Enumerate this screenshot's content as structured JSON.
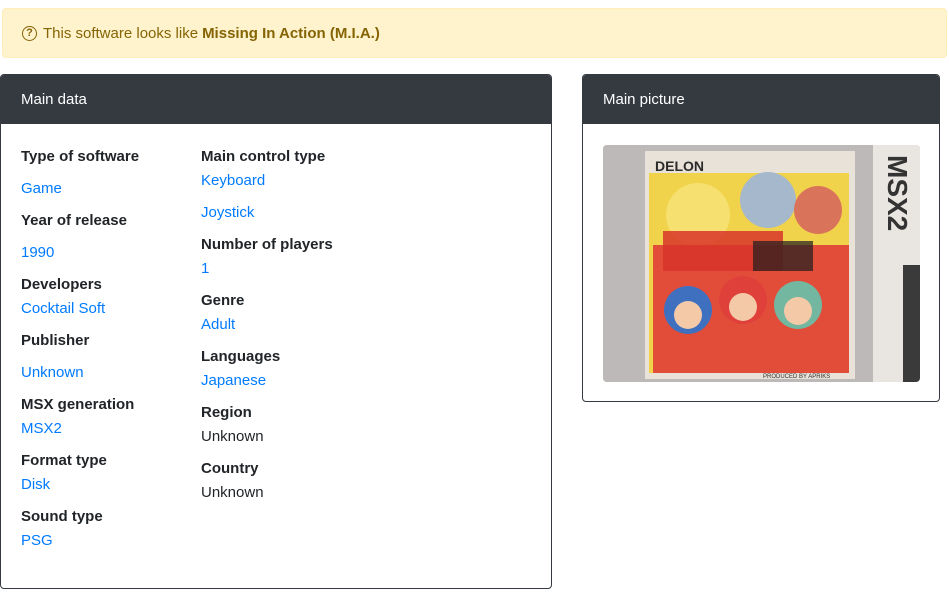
{
  "alert": {
    "prefix": "This software looks like",
    "title": "Missing In Action (M.I.A.)",
    "icon": "question-circle-icon"
  },
  "main_data": {
    "header": "Main data",
    "left": {
      "type_label": "Type of software",
      "type_value": "Game",
      "year_label": "Year of release",
      "year_value": "1990",
      "dev_label": "Developers",
      "dev_value": "Cocktail Soft",
      "pub_label": "Publisher",
      "pub_value": "Unknown",
      "gen_label": "MSX generation",
      "gen_value": "MSX2",
      "format_label": "Format type",
      "format_value": "Disk",
      "sound_label": "Sound type",
      "sound_value": "PSG"
    },
    "right": {
      "control_label": "Main control type",
      "control_value_1": "Keyboard",
      "control_value_2": "Joystick",
      "players_label": "Number of players",
      "players_value": "1",
      "genre_label": "Genre",
      "genre_value": "Adult",
      "lang_label": "Languages",
      "lang_value": "Japanese",
      "region_label": "Region",
      "region_value": "Unknown",
      "country_label": "Country",
      "country_value": "Unknown"
    }
  },
  "main_picture": {
    "header": "Main picture",
    "brand_text": "DELON",
    "side_text": "MSX2",
    "credit_text": "PRODUCED BY APRIKS"
  },
  "colors": {
    "link": "#007bff",
    "header_bg": "#343a40",
    "alert_bg": "#fff3cd",
    "alert_text": "#856404"
  }
}
